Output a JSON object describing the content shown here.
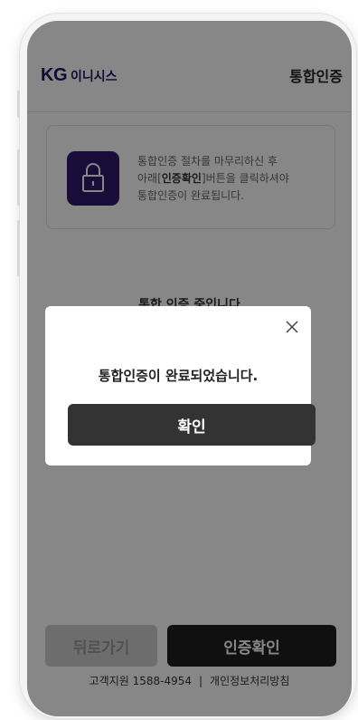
{
  "header": {
    "logo_kg": "KG",
    "logo_text": "이니시스",
    "title": "통합인증"
  },
  "info_card": {
    "icon": "lock-icon",
    "line1": "통합인증 절차를 마무리하신 후",
    "line2_prefix": "아래[",
    "line2_bold": "인증확인",
    "line2_suffix": "]버튼을 클릭하셔야",
    "line3": "통합인증이 완료됩니다."
  },
  "progress_text": "통합 인증 중입니다",
  "buttons": {
    "back": "뒤로가기",
    "confirm": "인증확인"
  },
  "footer": {
    "support": "고객지원 1588-4954",
    "separator": "|",
    "privacy": "개인정보처리방침"
  },
  "dialog": {
    "message": "통합인증이 완료되었습니다.",
    "button": "확인",
    "close_icon": "close-icon"
  },
  "colors": {
    "brand": "#2d1a6b",
    "button_dark": "#1f1f1f",
    "overlay": "rgba(0,0,0,0.47)"
  }
}
